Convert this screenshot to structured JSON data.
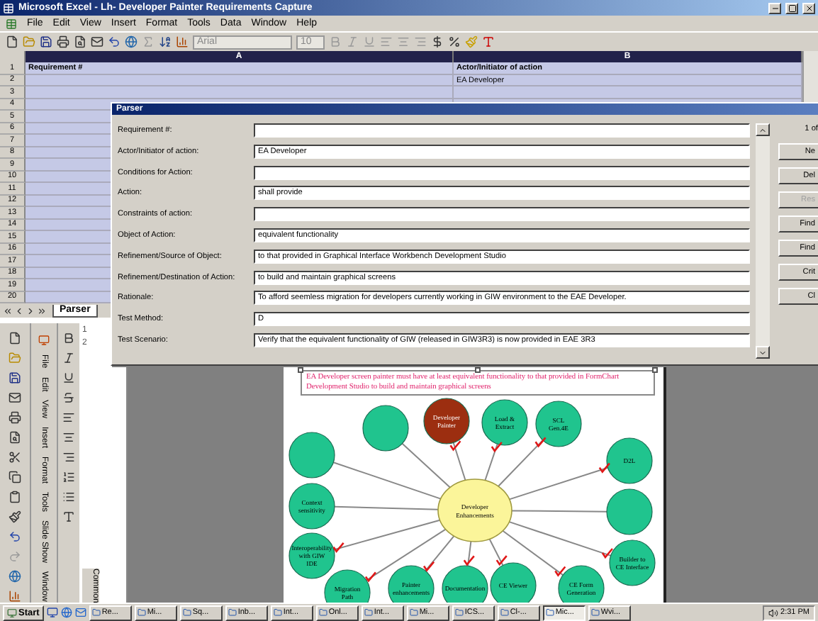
{
  "excel": {
    "title": "Microsoft Excel - Lh- Developer Painter Requirements Capture",
    "menu": [
      "File",
      "Edit",
      "View",
      "Insert",
      "Format",
      "Tools",
      "Data",
      "Window",
      "Help"
    ],
    "font": "Arial",
    "font_size": "10",
    "columns": [
      "A",
      "B"
    ],
    "rows": [
      {
        "number": "1",
        "a": "Requirement #",
        "b": "Actor/Initiator of action"
      },
      {
        "number": "2",
        "b": "EA Developer"
      },
      {
        "number": "3"
      },
      {
        "number": "4"
      },
      {
        "number": "5"
      },
      {
        "number": "6"
      },
      {
        "number": "7"
      },
      {
        "number": "8"
      },
      {
        "number": "9"
      },
      {
        "number": "10"
      },
      {
        "number": "11"
      },
      {
        "number": "12"
      },
      {
        "number": "13"
      },
      {
        "number": "14"
      },
      {
        "number": "15"
      },
      {
        "number": "16"
      },
      {
        "number": "17"
      },
      {
        "number": "18"
      },
      {
        "number": "19"
      },
      {
        "number": "20"
      }
    ],
    "sheet_tabs": [
      {
        "label": "Parser",
        "selected": true
      }
    ]
  },
  "dialog": {
    "title": "Parser",
    "fields": [
      {
        "label": "Requirement #:"
      },
      {
        "label": "Actor/Initiator of action:",
        "value": "EA Developer"
      },
      {
        "label": "Conditions for Action:"
      },
      {
        "label": "Action:",
        "value": "shall provide"
      },
      {
        "label": "Constraints of action:"
      },
      {
        "label": "Object of Action:",
        "value": "equivalent functionality"
      },
      {
        "label": "Refinement/Source of Object:",
        "value": "to that provided in Graphical Interface Workbench Development Studio"
      },
      {
        "label": "Refinement/Destination of Action:",
        "value": "to build and maintain graphical screens"
      },
      {
        "label": "Rationale:",
        "value": "To afford seemless migration for developers currently working in GIW environment to the EAE Developer."
      },
      {
        "label": "Test Method:",
        "value": "D"
      },
      {
        "label": "Test Scenario:",
        "value": "Verify that the equivalent functionality of GIW (released in GIW3R3) is now provided in EAE 3R3"
      }
    ],
    "record": "1 of",
    "buttons": [
      {
        "label": "Ne",
        "disabled": false
      },
      {
        "label": "Del",
        "disabled": false
      },
      {
        "label": "Res",
        "disabled": true
      },
      {
        "label": "Find",
        "disabled": false
      },
      {
        "label": "Find",
        "disabled": false
      },
      {
        "label": "Crit",
        "disabled": false
      },
      {
        "label": "Cl",
        "disabled": false
      }
    ]
  },
  "powerpoint": {
    "menu": [
      "File",
      "Edit",
      "View",
      "Insert",
      "Format",
      "Tools",
      "Slide Show",
      "Window"
    ],
    "slides": [
      "1",
      "2"
    ],
    "pane_label": "Common",
    "note": "EA Developer screen painter must have at least equivalent functionality to that provided in FormChart Development Studio to build and maintain graphical screens",
    "center": [
      "Developer",
      "Enhancements"
    ],
    "nodes": [
      {
        "color": "#20c48e",
        "checked": false
      },
      {
        "lines": [
          "Developer",
          "Painter"
        ],
        "color": "#9c2e10",
        "checked": true
      },
      {
        "lines": [
          "Load &",
          "Extract"
        ],
        "color": "#20c48e",
        "checked": true
      },
      {
        "lines": [
          "SCL",
          "Gen.4E"
        ],
        "color": "#20c48e",
        "checked": true
      },
      {
        "lines": [
          "D2L"
        ],
        "color": "#20c48e",
        "checked": true
      },
      {
        "color": "#20c48e",
        "checked": false
      },
      {
        "lines": [
          "Context",
          "sensitivity"
        ],
        "color": "#20c48e",
        "checked": false
      },
      {
        "color": "#20c48e",
        "checked": false
      },
      {
        "lines": [
          "Interoperability",
          "with GIW",
          "IDE"
        ],
        "color": "#20c48e",
        "checked": true
      },
      {
        "lines": [
          "Builder to",
          "CE Interface"
        ],
        "color": "#20c48e",
        "checked": true
      },
      {
        "lines": [
          "Migration",
          "Path"
        ],
        "color": "#20c48e",
        "checked": true
      },
      {
        "lines": [
          "Painter",
          "enhancements"
        ],
        "color": "#20c48e",
        "checked": true
      },
      {
        "lines": [
          "Documentation"
        ],
        "color": "#20c48e",
        "checked": true
      },
      {
        "lines": [
          "CE Viewer"
        ],
        "color": "#20c48e",
        "checked": true
      },
      {
        "lines": [
          "CE Form",
          "Generation"
        ],
        "color": "#20c48e",
        "checked": true
      }
    ]
  },
  "taskbar": {
    "start": "Start",
    "tasks": [
      {
        "label": "Re...",
        "selected": false
      },
      {
        "label": "Mi...",
        "selected": false
      },
      {
        "label": "Sq...",
        "selected": false
      },
      {
        "label": "Inb...",
        "selected": false
      },
      {
        "label": "Int...",
        "selected": false
      },
      {
        "label": "Onl...",
        "selected": false
      },
      {
        "label": "Int...",
        "selected": false
      },
      {
        "label": "Mi...",
        "selected": false
      },
      {
        "label": "ICS...",
        "selected": false
      },
      {
        "label": "Cl-...",
        "selected": false
      },
      {
        "label": "Mic...",
        "selected": true
      },
      {
        "label": "Wvi...",
        "selected": false
      }
    ],
    "clock": "2:31 PM"
  }
}
